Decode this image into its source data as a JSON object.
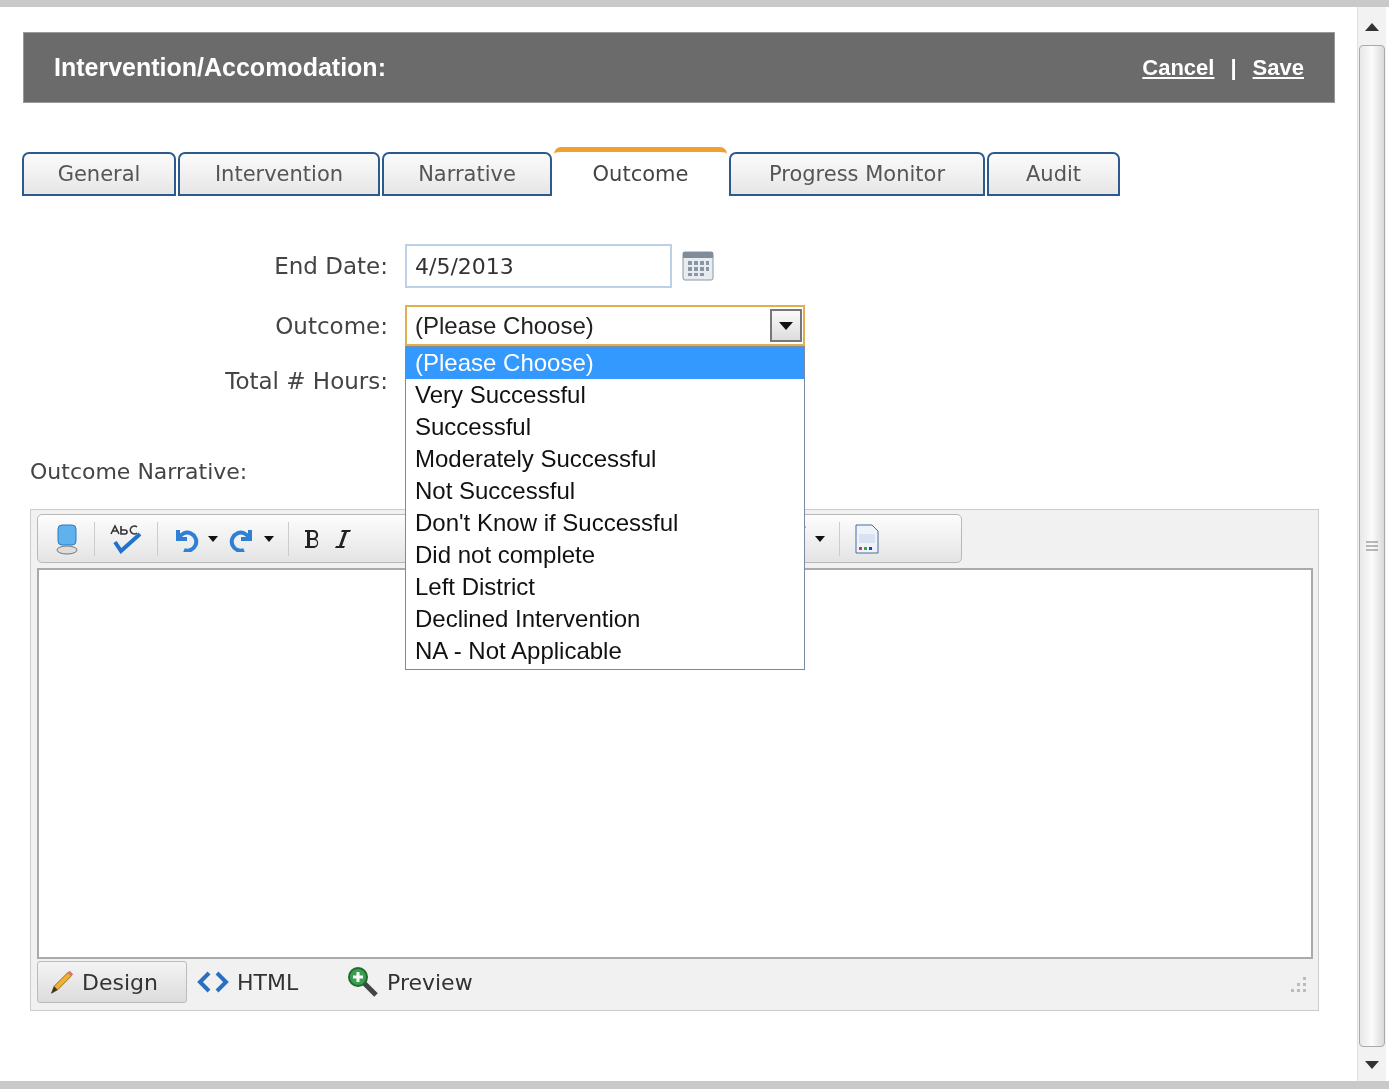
{
  "header": {
    "title": "Intervention/Accomodation:",
    "actions": [
      "Cancel",
      "Save"
    ],
    "separator": "|"
  },
  "tabs": [
    {
      "label": "General",
      "selected": false
    },
    {
      "label": "Intervention",
      "selected": false
    },
    {
      "label": "Narrative",
      "selected": false
    },
    {
      "label": "Outcome",
      "selected": true
    },
    {
      "label": "Progress Monitor",
      "selected": false
    },
    {
      "label": "Audit",
      "selected": false
    }
  ],
  "end_date": {
    "label": "End Date:",
    "value": "4/5/2013"
  },
  "outcome": {
    "label": "Outcome:",
    "value": "(Please Choose)",
    "expanded": true,
    "options": [
      {
        "label": "(Please Choose)",
        "selected": true
      },
      {
        "label": "Very Successful",
        "selected": false
      },
      {
        "label": "Successful",
        "selected": false
      },
      {
        "label": "Moderately Successful",
        "selected": false
      },
      {
        "label": "Not Successful",
        "selected": false
      },
      {
        "label": "Don't Know if Successful",
        "selected": false
      },
      {
        "label": "Did not complete",
        "selected": false
      },
      {
        "label": "Left District",
        "selected": false
      },
      {
        "label": "Declined Intervention",
        "selected": false
      },
      {
        "label": "NA - Not Applicable",
        "selected": false
      }
    ]
  },
  "total_hours": {
    "label": "Total # Hours:"
  },
  "narrative": {
    "label": "Outcome Narrative:",
    "modes": [
      {
        "label": "Design",
        "selected": true,
        "kind": "design"
      },
      {
        "label": "HTML",
        "selected": false,
        "kind": "html"
      },
      {
        "label": "Preview",
        "selected": false,
        "kind": "preview"
      }
    ]
  }
}
